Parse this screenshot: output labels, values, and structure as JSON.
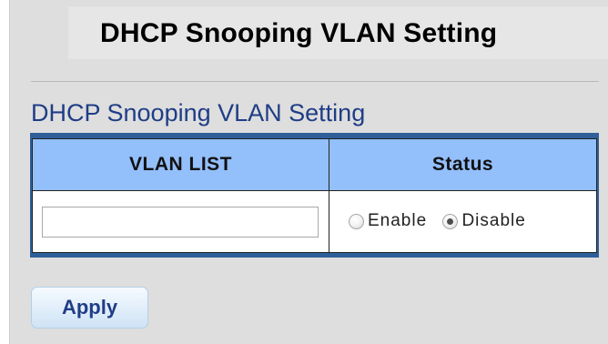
{
  "header": {
    "title": "DHCP Snooping VLAN Setting"
  },
  "section": {
    "title": "DHCP Snooping VLAN Setting"
  },
  "table": {
    "columns": [
      "VLAN LIST",
      "Status"
    ],
    "vlan_list_value": "",
    "status_options": [
      {
        "label": "Enable",
        "selected": false
      },
      {
        "label": "Disable",
        "selected": true
      }
    ]
  },
  "actions": {
    "apply_label": "Apply"
  },
  "colors": {
    "section_title": "#1f3d86",
    "table_header_bg": "#93bffb",
    "table_border": "#2f5f98",
    "background": "#dedede"
  }
}
